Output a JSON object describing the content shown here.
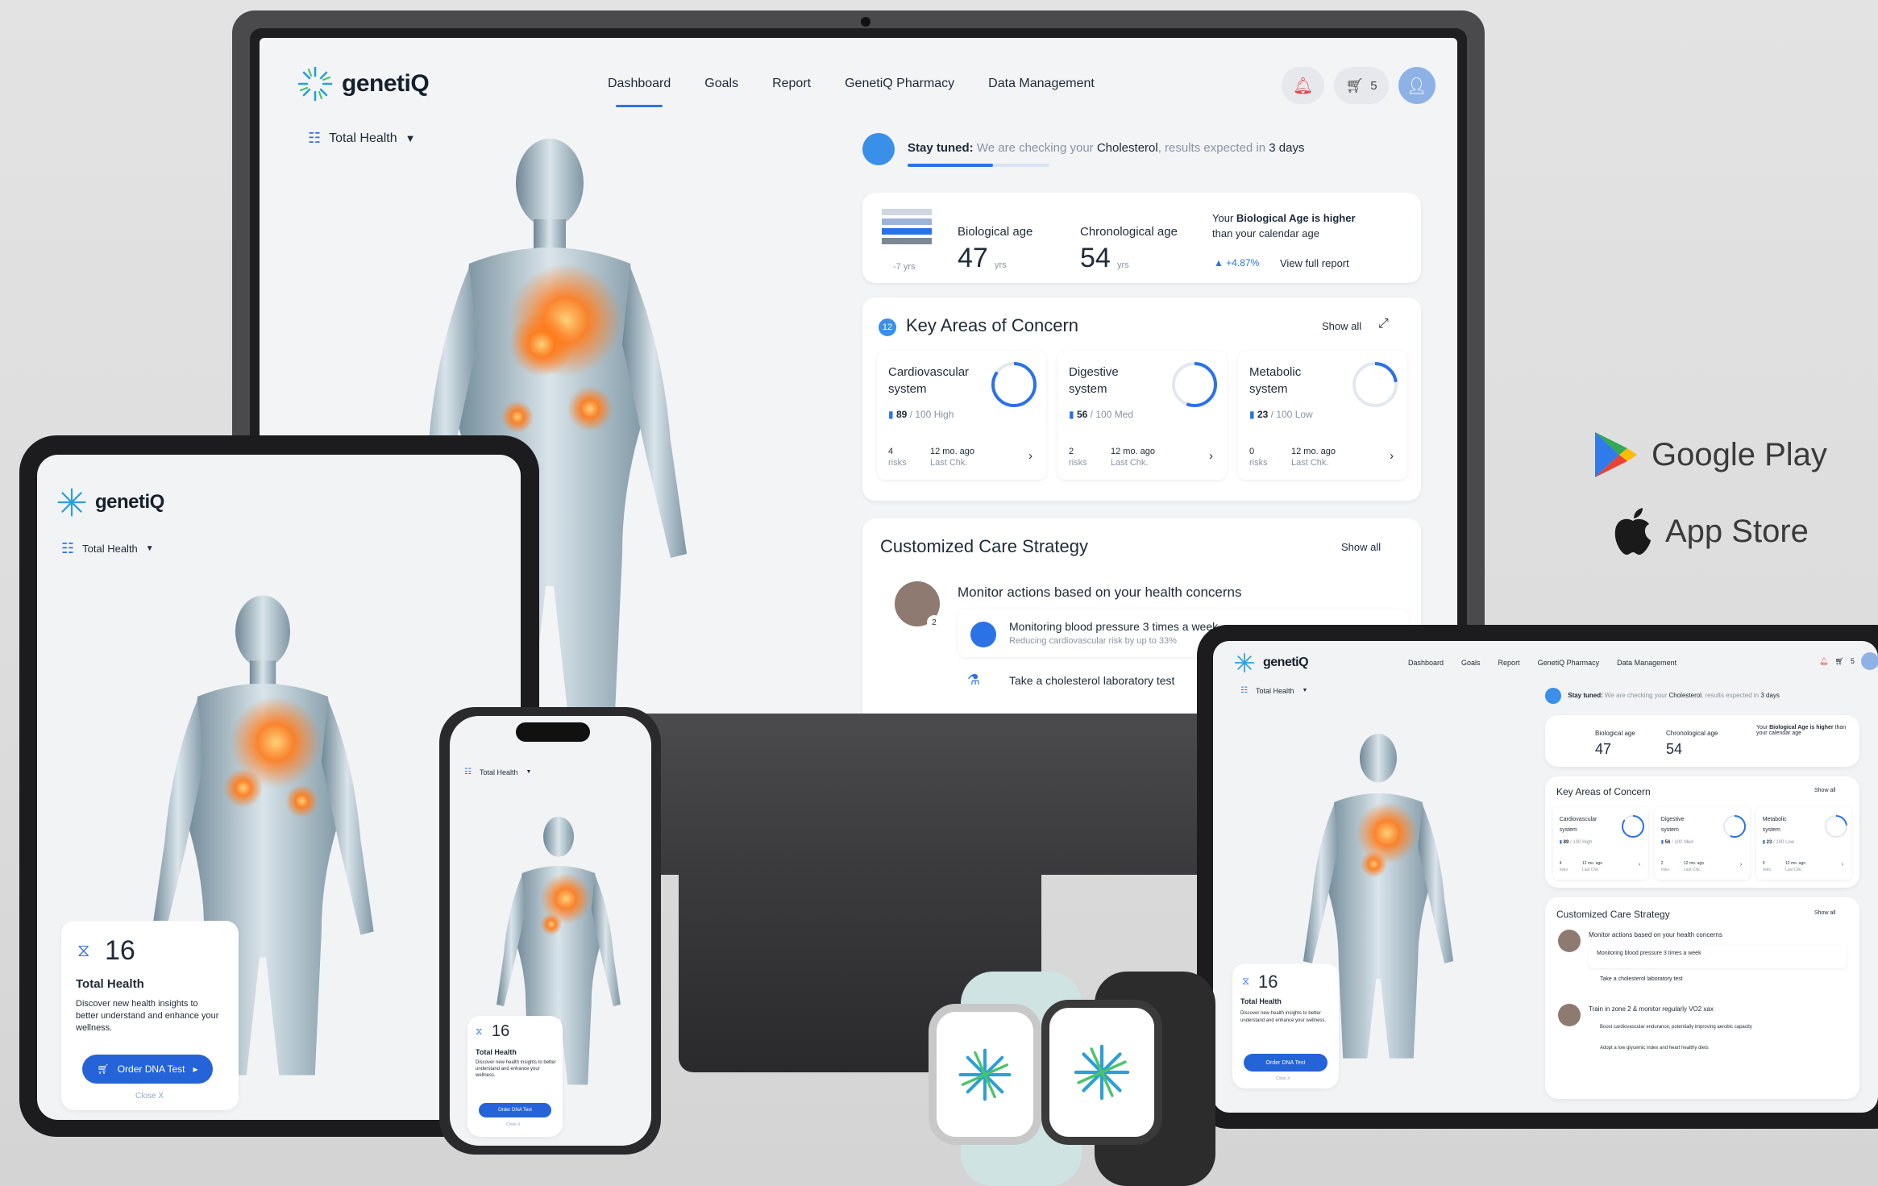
{
  "brand": {
    "name": "genetiQ",
    "accent": "#2b72e6",
    "hotspot": "#ff7a1a"
  },
  "nav": {
    "items": [
      "Dashboard",
      "Goals",
      "Report",
      "GenetiQ Pharmacy",
      "Data Management"
    ],
    "active": "Dashboard"
  },
  "header": {
    "cart_count": "5",
    "icons": [
      "bell-icon",
      "cart-icon",
      "user-icon"
    ]
  },
  "selector": {
    "label": "Total Health"
  },
  "status": {
    "title": "Stay tuned:",
    "text_pre": "We are checking your",
    "text_bold": "Cholesterol",
    "text_mid": ", results expected in",
    "text_days": "3 days",
    "progress": 0.6
  },
  "age": {
    "bio_label": "Biological age",
    "bio_value": "47",
    "unit": "yrs",
    "chrono_label": "Chronological age",
    "chrono_value": "54",
    "diff": "-7 yrs",
    "msg_pre": "Your",
    "msg_bold": "Biological Age is higher",
    "msg_post": "than your calendar age",
    "change": "▲ +4.87%",
    "link": "View full report"
  },
  "concerns": {
    "badge": "12",
    "title": "Key Areas of Concern",
    "show_all": "Show all",
    "items": [
      {
        "name1": "Cardiovascular",
        "name2": "system",
        "score": "89",
        "max": "/ 100",
        "level": "High",
        "risks": "4",
        "risks_label": "risks",
        "when": "12 mo. ago",
        "when_label": "Last Chk.",
        "arc": 0.85
      },
      {
        "name1": "Digestive",
        "name2": "system",
        "score": "56",
        "max": "/ 100",
        "level": "Med",
        "risks": "2",
        "risks_label": "risks",
        "when": "12 mo. ago",
        "when_label": "Last Chk.",
        "arc": 0.56
      },
      {
        "name1": "Metabolic",
        "name2": "system",
        "score": "23",
        "max": "/ 100",
        "level": "Low",
        "risks": "0",
        "risks_label": "risks",
        "when": "12 mo. ago",
        "when_label": "Last Chk.",
        "arc": 0.23
      }
    ]
  },
  "care": {
    "title": "Customized Care Strategy",
    "show_all": "Show all",
    "group1_title": "Monitor actions based on your health concerns",
    "group1_badge": "2",
    "action1_title": "Monitoring blood pressure 3 times a week",
    "action1_sub": "Reducing cardiovascular risk by up to 33%",
    "action2_title": "Take a cholesterol laboratory test",
    "group2_title": "Train in zone 2 & monitor regularly VO2 xax",
    "action3_title": "Boost cardiovascular endurance, potentially improving aerobic capacity",
    "action4_title": "Adopt a low glycemic index and heart healthy diets"
  },
  "promo": {
    "count": "16",
    "title": "Total Health",
    "text": "Discover new health insights to better understand and enhance your wellness.",
    "button": "Order DNA Test",
    "close": "Close X"
  },
  "stores": {
    "google": "Google Play",
    "apple": "App Store"
  }
}
